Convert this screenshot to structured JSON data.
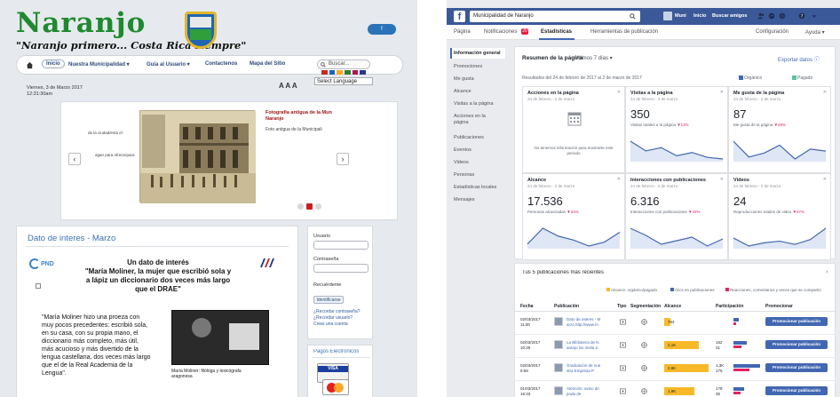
{
  "website": {
    "logo_text": "Naranjo",
    "slogan": "\"Naranjo primero... Costa Rica siempre\"",
    "facebook_button": "f",
    "nav": {
      "items": [
        "Inicio",
        "Nuestra Municipalidad ▾",
        "Guía al Usuario ▾",
        "Contactenos",
        "Mapa del Sitio"
      ],
      "search_placeholder": "Buscar..."
    },
    "language_select": "Select Language",
    "flag_colors": [
      "#c62828",
      "#1565c0",
      "#f9a825",
      "#2e7d32",
      "#ad1457",
      "#283593"
    ],
    "date_line1": "Viernes, 3 de Marzo 2017",
    "date_line2": "12:31:30am",
    "font_size_control": "A A A",
    "slider": {
      "side_text1": "de la ciudad/esta el",
      "side_text2": "agan para ofrecerpara",
      "photo_title": "Fotografía antigua de la Mun Naranjo",
      "photo_desc": "Foto antigua de la Municipali",
      "prev": "‹",
      "next": "›",
      "dots": [
        false,
        true,
        false
      ]
    },
    "dato": {
      "title": "Dato de interes - Marzo",
      "pnd_logo": "PND",
      "heading_lines": [
        "Un dato de interés",
        "\"María Moliner, la mujer que escribió sola y",
        "a lápiz un diccionario dos veces más largo",
        "que el DRAE\""
      ],
      "quote_lines": [
        "\"María Moliner hizo una proeza con",
        "muy pocos precedentes: escribió sola,",
        "en su casa, con su propia mano, el",
        "diccionario más completo, más útil,",
        "más acucioso y más divertido de la",
        "lengua castellana, dos veces más largo",
        "que el de la Real Academia de la",
        "Lengua\"."
      ],
      "photo_caption1": "María Moliner: filóloga y lexicógrafa",
      "photo_caption2": "aragonesa"
    },
    "login": {
      "user_label": "Usuario",
      "pass_label": "Contraseña",
      "remember_label": "Recuérdeme",
      "submit": "Identificarse",
      "forgot_pass": "¿Recordar contraseña?",
      "forgot_user": "¿Recordar usuario?",
      "create": "Crear una cuenta"
    },
    "pagos": {
      "title": "Pagos Electrónicos",
      "visa": "VISA"
    }
  },
  "insights": {
    "topbar": {
      "search_value": "Municipalidad de Naranjo",
      "user_name": "Muni",
      "home": "Inicio",
      "find_friends": "Buscar amigos"
    },
    "pagebar": {
      "tabs": [
        "Página",
        "Notificaciones",
        "Estadísticas",
        "Herramientas de publicación"
      ],
      "notif_count": "20",
      "config": "Configuración",
      "help": "Ayuda ▾"
    },
    "sidenav": [
      "Información general",
      "Promociones",
      "Me gusta",
      "Alcance",
      "Visitas a la página",
      "Acciones en la página",
      "Publicaciones",
      "Eventos",
      "Videos",
      "Personas",
      "Estadísticas locales",
      "Mensajes"
    ],
    "summary": {
      "title": "Resumen de la página",
      "range": "Últimos 7 días ▾",
      "export": "Exportar datos ⓘ",
      "results_note": "Resultados del 24 de febrero de 2017 al 2 de marzo de 2017",
      "legend_organic": "Orgánico",
      "legend_paid": "Pagado"
    },
    "cards": [
      {
        "title": "Acciones en la página",
        "range": "24 de febrero - 2 de marzo",
        "value": "",
        "sub": "",
        "pct": "",
        "empty": "No tenemos información para mostrarte este periodo",
        "spark": []
      },
      {
        "title": "Visitas a la página",
        "range": "24 de febrero - 2 de marzo",
        "value": "350",
        "sub": "Visitas totales a la página",
        "pct": "▼13%",
        "empty": "",
        "spark": [
          20,
          14,
          16,
          11,
          13,
          10,
          9
        ]
      },
      {
        "title": "Me gusta de la página",
        "range": "24 de febrero - 2 de marzo",
        "value": "87",
        "sub": "Me gusta de la página",
        "pct": "▼48%",
        "empty": "",
        "spark": [
          18,
          10,
          12,
          16,
          9,
          14,
          13
        ]
      },
      {
        "title": "Alcance",
        "range": "24 de febrero - 2 de marzo",
        "value": "17.536",
        "sub": "Personas alcanzadas",
        "pct": "▼34%",
        "empty": "",
        "spark": [
          10,
          18,
          14,
          12,
          9,
          11,
          16
        ]
      },
      {
        "title": "Interacciones con publicaciones",
        "range": "24 de febrero - 2 de marzo",
        "value": "6.316",
        "sub": "Interacciones con publicaciones",
        "pct": "▼42%",
        "empty": "",
        "spark": [
          19,
          15,
          10,
          12,
          14,
          9,
          13
        ]
      },
      {
        "title": "Videos",
        "range": "24 de febrero - 2 de marzo",
        "value": "24",
        "sub": "Reproducciones totales de video",
        "pct": "▼67%",
        "empty": "",
        "spark": [
          14,
          9,
          11,
          12,
          10,
          13,
          20
        ]
      }
    ],
    "recent_posts": {
      "title": "Tus 5 publicaciones más recientes",
      "legend": [
        "Alcance: orgánico/pagado",
        "Clics en publicaciones",
        "Reacciones, comentarios y veces que se compartió"
      ],
      "headers": [
        "Fecha",
        "Publicación",
        "Tipo",
        "Segmentación",
        "Alcance",
        "Participación",
        "Promocionar"
      ],
      "rows": [
        {
          "date": [
            "02/03/2017",
            "11:00"
          ],
          "text": [
            "Dato de interes - M",
            "arzo http://www.m"
          ],
          "reach": "764",
          "reach_frac": 0.12,
          "part": [
            "",
            ""
          ],
          "click_frac": 0.2,
          "react_frac": 0.1,
          "promote": "Promocionar publicación"
        },
        {
          "date": [
            "02/03/2017",
            "10:26"
          ],
          "text": [
            "La Biblioteca de N",
            "aranjo los invita a"
          ],
          "reach": "2,1K",
          "reach_frac": 0.7,
          "part": [
            "162",
            "31"
          ],
          "click_frac": 0.5,
          "react_frac": 0.3,
          "promote": "Promocionar publicación"
        },
        {
          "date": [
            "02/03/2017",
            "9:59"
          ],
          "text": [
            "Graduación de nue",
            "stra Empresa P"
          ],
          "reach": "2,8K",
          "reach_frac": 0.9,
          "part": [
            "1,3K",
            "175"
          ],
          "click_frac": 1,
          "react_frac": 0.6,
          "promote": "Promocionar publicación"
        },
        {
          "date": [
            "01/03/2017",
            "16:33"
          ],
          "text": [
            "Atención: aviso de",
            "poda de"
          ],
          "reach": "1,9K",
          "reach_frac": 0.6,
          "part": [
            "178",
            "35"
          ],
          "click_frac": 0.4,
          "react_frac": 0.25,
          "promote": "Promocionar publicación"
        }
      ]
    }
  }
}
